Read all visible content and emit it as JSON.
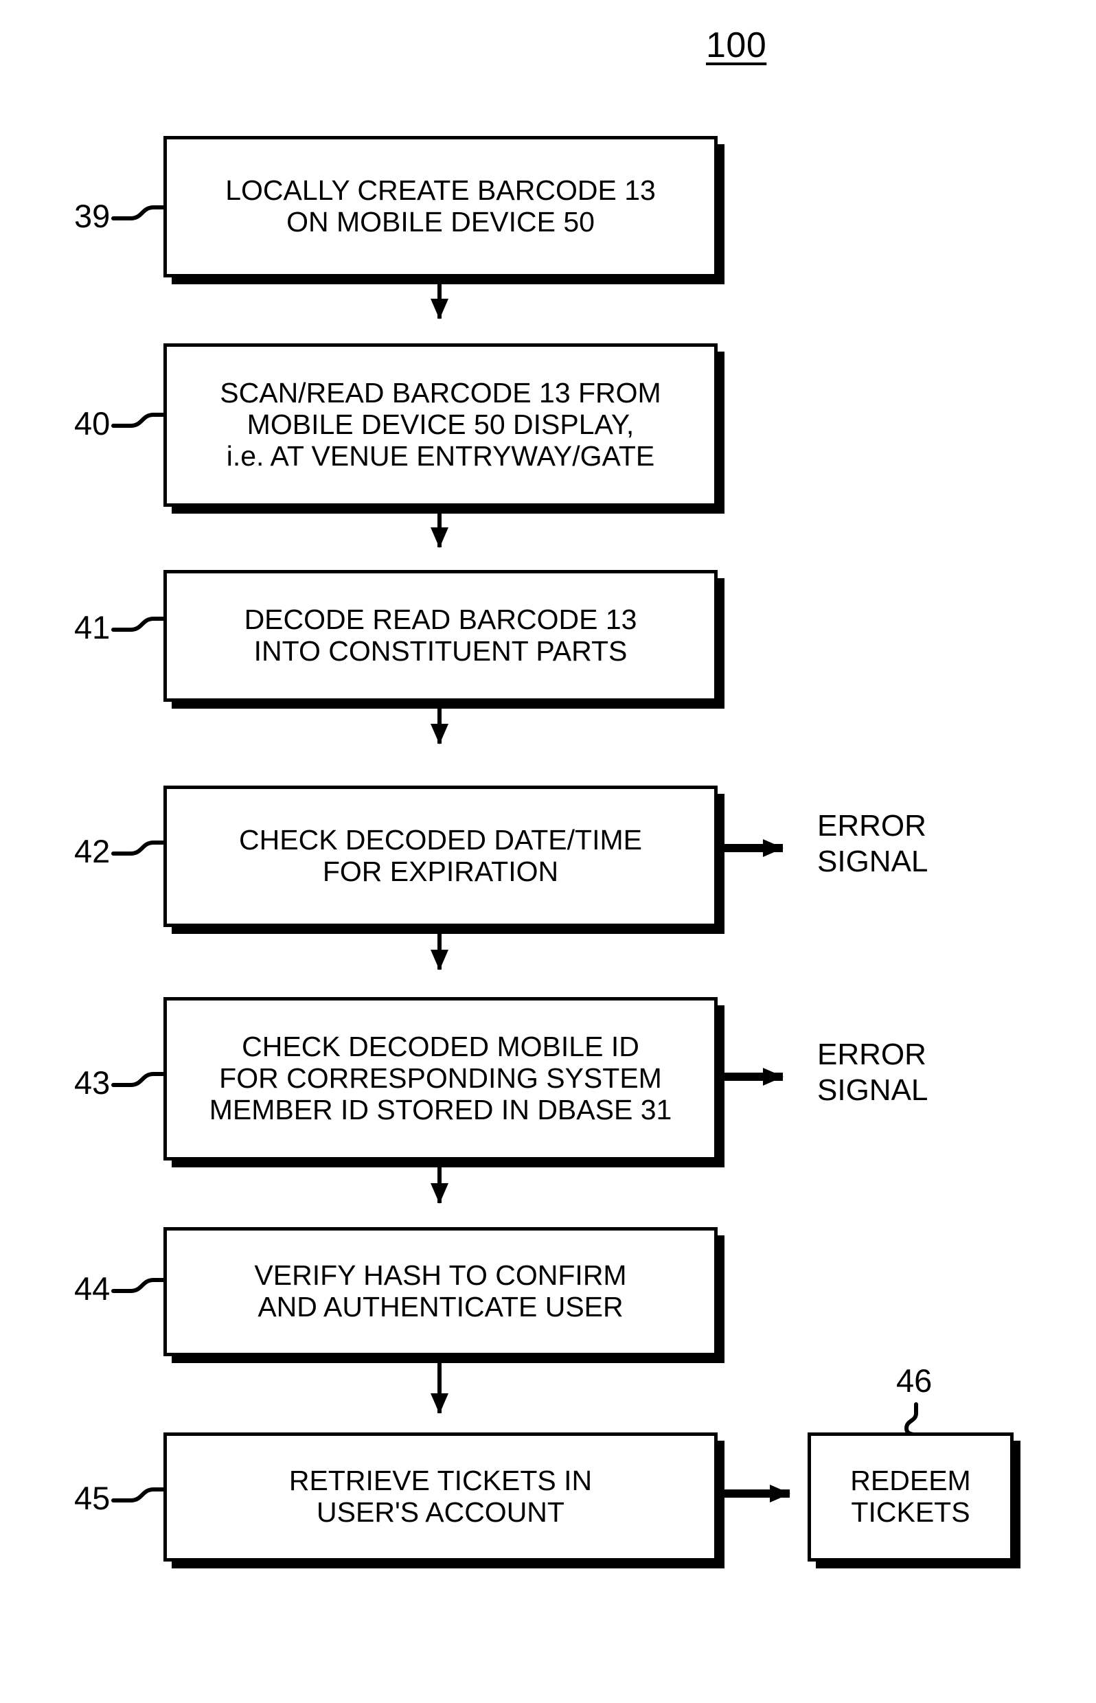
{
  "figure": {
    "number": "100"
  },
  "boxes": [
    {
      "ref": "39",
      "text": "LOCALLY CREATE BARCODE 13\nON MOBILE DEVICE 50",
      "name": "step-39-locally-create-barcode"
    },
    {
      "ref": "40",
      "text": "SCAN/READ BARCODE 13 FROM\nMOBILE DEVICE 50 DISPLAY,\ni.e. AT VENUE ENTRYWAY/GATE",
      "name": "step-40-scan-read-barcode"
    },
    {
      "ref": "41",
      "text": "DECODE READ BARCODE 13\nINTO CONSTITUENT PARTS",
      "name": "step-41-decode-barcode"
    },
    {
      "ref": "42",
      "text": "CHECK DECODED DATE/TIME\nFOR EXPIRATION",
      "name": "step-42-check-date-time"
    },
    {
      "ref": "43",
      "text": "CHECK DECODED MOBILE ID\nFOR CORRESPONDING SYSTEM\nMEMBER ID STORED IN DBASE 31",
      "name": "step-43-check-mobile-id"
    },
    {
      "ref": "44",
      "text": "VERIFY HASH TO CONFIRM\nAND AUTHENTICATE USER",
      "name": "step-44-verify-hash"
    },
    {
      "ref": "45",
      "text": "RETRIEVE TICKETS IN\nUSER'S ACCOUNT",
      "name": "step-45-retrieve-tickets"
    },
    {
      "ref": "46",
      "text": "REDEEM\nTICKETS",
      "name": "step-46-redeem-tickets"
    }
  ],
  "branch_labels": [
    {
      "text": "ERROR\nSIGNAL",
      "name": "error-signal-label-42"
    },
    {
      "text": "ERROR\nSIGNAL",
      "name": "error-signal-label-43"
    }
  ],
  "colors": {
    "ink": "#000000",
    "paper": "#ffffff"
  }
}
